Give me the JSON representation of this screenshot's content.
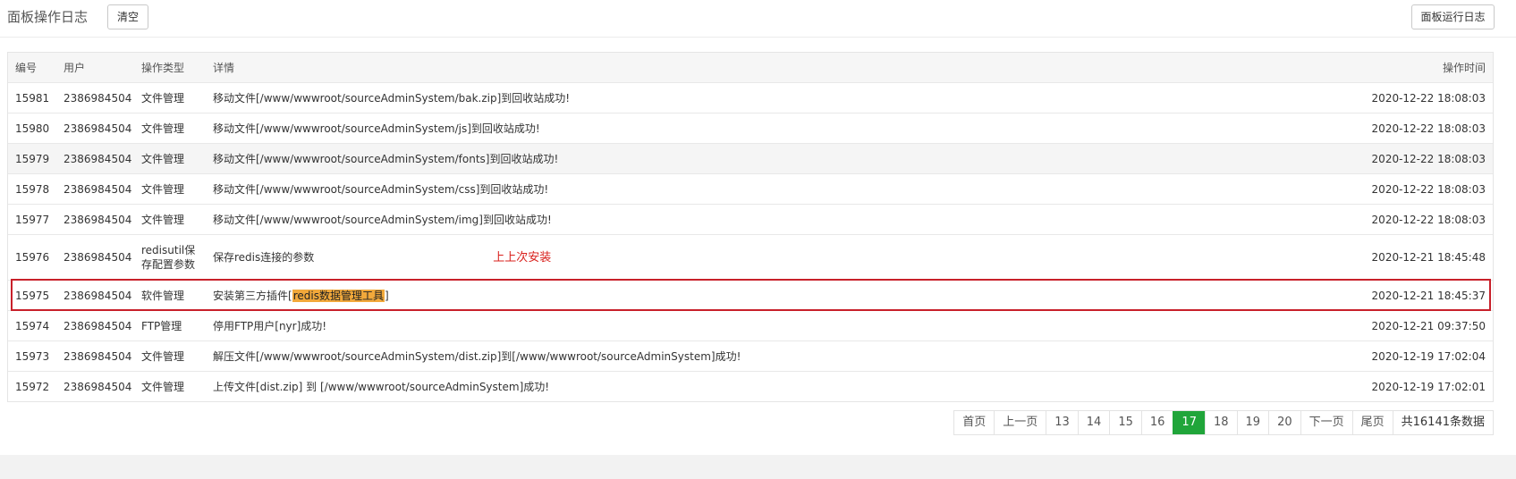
{
  "header": {
    "title": "面板操作日志",
    "clear_label": "清空",
    "run_log_label": "面板运行日志"
  },
  "table": {
    "columns": [
      "编号",
      "用户",
      "操作类型",
      "详情",
      "操作时间"
    ],
    "rows": [
      {
        "id": "15981",
        "user": "2386984504",
        "type": "文件管理",
        "detail": "移动文件[/www/wwwroot/sourceAdminSystem/bak.zip]到回收站成功!",
        "time": "2020-12-22 18:08:03"
      },
      {
        "id": "15980",
        "user": "2386984504",
        "type": "文件管理",
        "detail": "移动文件[/www/wwwroot/sourceAdminSystem/js]到回收站成功!",
        "time": "2020-12-22 18:08:03"
      },
      {
        "id": "15979",
        "user": "2386984504",
        "type": "文件管理",
        "detail": "移动文件[/www/wwwroot/sourceAdminSystem/fonts]到回收站成功!",
        "time": "2020-12-22 18:08:03"
      },
      {
        "id": "15978",
        "user": "2386984504",
        "type": "文件管理",
        "detail": "移动文件[/www/wwwroot/sourceAdminSystem/css]到回收站成功!",
        "time": "2020-12-22 18:08:03"
      },
      {
        "id": "15977",
        "user": "2386984504",
        "type": "文件管理",
        "detail": "移动文件[/www/wwwroot/sourceAdminSystem/img]到回收站成功!",
        "time": "2020-12-22 18:08:03"
      },
      {
        "id": "15976",
        "user": "2386984504",
        "type": "redisutil保存配置参数",
        "detail": "保存redis连接的参数",
        "time": "2020-12-21 18:45:48"
      },
      {
        "id": "15975",
        "user": "2386984504",
        "type": "软件管理",
        "detail_prefix": "安装第三方插件[",
        "detail_highlight": "redis数据管理工具",
        "detail_suffix": "]",
        "time": "2020-12-21 18:45:37"
      },
      {
        "id": "15974",
        "user": "2386984504",
        "type": "FTP管理",
        "detail": "停用FTP用户[nyr]成功!",
        "time": "2020-12-21 09:37:50"
      },
      {
        "id": "15973",
        "user": "2386984504",
        "type": "文件管理",
        "detail": "解压文件[/www/wwwroot/sourceAdminSystem/dist.zip]到[/www/wwwroot/sourceAdminSystem]成功!",
        "time": "2020-12-19 17:02:04"
      },
      {
        "id": "15972",
        "user": "2386984504",
        "type": "文件管理",
        "detail": "上传文件[dist.zip] 到 [/www/wwwroot/sourceAdminSystem]成功!",
        "time": "2020-12-19 17:02:01"
      }
    ]
  },
  "annotation": {
    "text": "上上次安装"
  },
  "pagination": {
    "first": "首页",
    "prev": "上一页",
    "pages": [
      "13",
      "14",
      "15",
      "16",
      "17",
      "18",
      "19",
      "20"
    ],
    "current": "17",
    "next": "下一页",
    "last": "尾页",
    "total": "共16141条数据"
  },
  "colors": {
    "active_page": "#20a53a",
    "annotation_red": "#c8202a",
    "highlight_orange": "#f2a93b"
  }
}
